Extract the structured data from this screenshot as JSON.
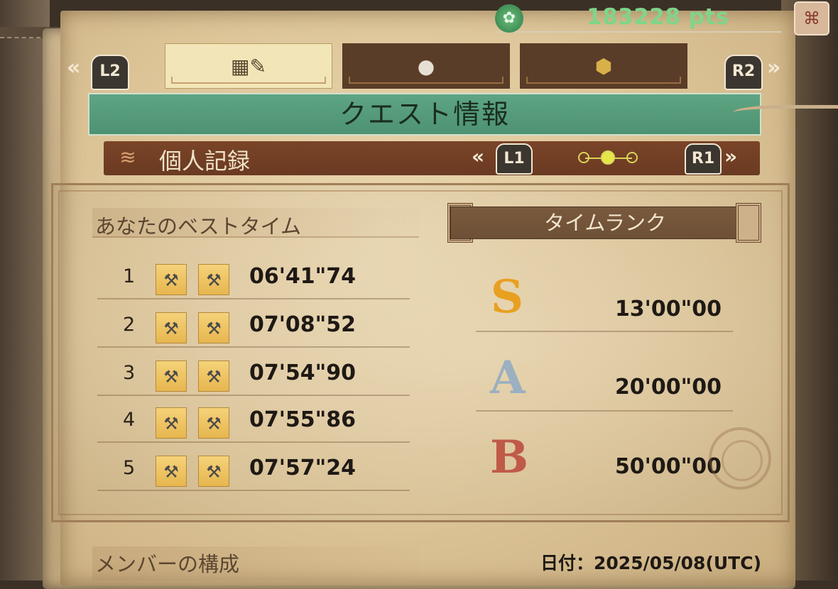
{
  "header": {
    "points": "183228 pts",
    "emblem_icon": "guild-emblem-icon",
    "corner_icon": "map-icon"
  },
  "tabs": {
    "left_shoulder": "L2",
    "right_shoulder": "R2",
    "items": [
      {
        "icon": "quest-info-icon",
        "glyph": "▦",
        "active": true
      },
      {
        "icon": "hint-bulb-icon",
        "glyph": "💡",
        "active": false
      },
      {
        "icon": "monster-crest-icon",
        "glyph": "⬢",
        "active": false
      }
    ]
  },
  "title": "クエスト情報",
  "subheader": {
    "title": "個人記録",
    "left_button": "L1",
    "right_button": "R1",
    "page_index": 2,
    "page_count": 3
  },
  "best_times": {
    "title": "あなたのベストタイム",
    "rows": [
      {
        "rank": "1",
        "weapon1": "hammer-icon",
        "weapon2": "hammer-icon",
        "time": "06'41\"74"
      },
      {
        "rank": "2",
        "weapon1": "hammer-icon",
        "weapon2": "hammer-icon",
        "time": "07'08\"52"
      },
      {
        "rank": "3",
        "weapon1": "hammer-icon",
        "weapon2": "hammer-icon",
        "time": "07'54\"90"
      },
      {
        "rank": "4",
        "weapon1": "hammer-icon",
        "weapon2": "hammer-icon",
        "time": "07'55\"86"
      },
      {
        "rank": "5",
        "weapon1": "hammer-icon",
        "weapon2": "hammer-icon",
        "time": "07'57\"24"
      }
    ]
  },
  "time_rank": {
    "title": "タイムランク",
    "rows": [
      {
        "letter": "S",
        "color": "#e8a020",
        "time": "13'00\"00"
      },
      {
        "letter": "A",
        "color": "#9bb0c0",
        "time": "20'00\"00"
      },
      {
        "letter": "B",
        "color": "#c05a48",
        "time": "50'00\"00"
      }
    ]
  },
  "footer": {
    "members_title": "メンバーの構成",
    "date": "日付：2025/05/08(UTC)"
  }
}
